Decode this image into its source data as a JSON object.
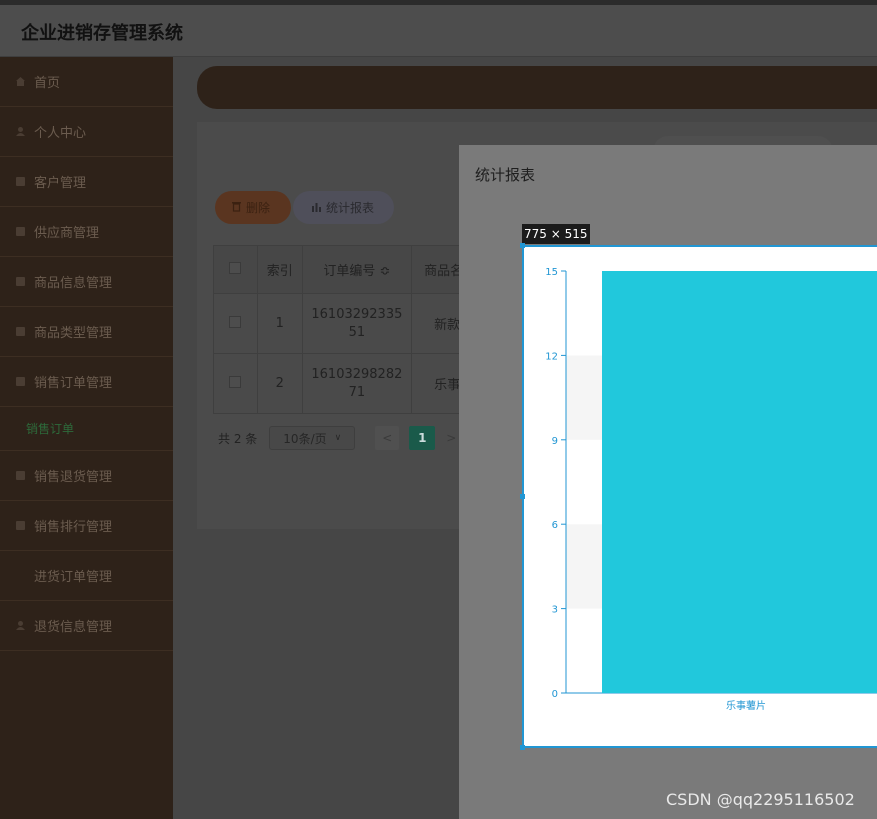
{
  "app": {
    "title": "企业进销存管理系统"
  },
  "sidebar": {
    "items": [
      {
        "label": "首页",
        "icon": "home-icon"
      },
      {
        "label": "个人中心",
        "icon": "user-icon"
      },
      {
        "label": "客户管理",
        "icon": "list-icon"
      },
      {
        "label": "供应商管理",
        "icon": "list-icon"
      },
      {
        "label": "商品信息管理",
        "icon": "list-icon"
      },
      {
        "label": "商品类型管理",
        "icon": "list-icon"
      },
      {
        "label": "销售订单管理",
        "icon": "list-icon"
      }
    ],
    "active_subitem": "销售订单",
    "items_after": [
      {
        "label": "销售退货管理",
        "icon": "list-icon"
      },
      {
        "label": "销售排行管理",
        "icon": "list-icon"
      },
      {
        "label": "进货订单管理",
        "icon": ""
      },
      {
        "label": "退货信息管理",
        "icon": "user-icon"
      }
    ]
  },
  "toolbar": {
    "delete_label": "删除",
    "stats_label": "统计报表"
  },
  "table": {
    "headers": [
      "",
      "索引",
      "订单编号",
      "商品名"
    ],
    "header_visible": [
      "",
      "索引",
      "订单编号 ≎",
      "商品名"
    ],
    "rows": [
      {
        "index": "1",
        "order_no": "1610329233551",
        "product": "新款"
      },
      {
        "index": "2",
        "order_no": "1610329828271",
        "product": "乐事"
      }
    ]
  },
  "pager": {
    "total": "共 2 条",
    "page_size": "10条/页",
    "current": "1",
    "prev": "<",
    "next": ">"
  },
  "dialog": {
    "title": "统计报表"
  },
  "size_tag": "775 × 515",
  "chart_data": {
    "type": "bar",
    "categories": [
      "乐事薯片"
    ],
    "values": [
      15
    ],
    "ylim": [
      0,
      15
    ],
    "yticks": [
      0,
      3,
      6,
      9,
      12,
      15
    ],
    "bar_color": "#21c8dc",
    "axis_color": "#2196d3"
  },
  "watermark": "CSDN @qq2295116502"
}
